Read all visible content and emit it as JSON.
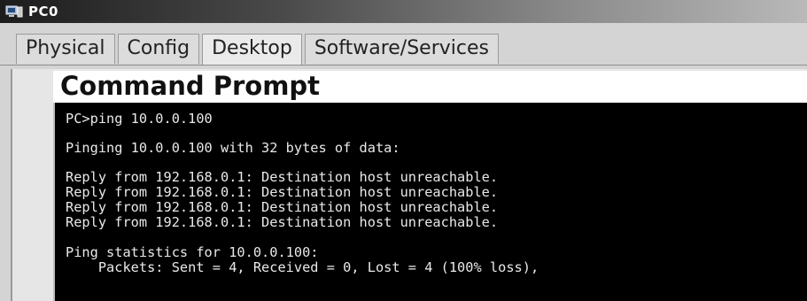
{
  "window": {
    "title": "PC0"
  },
  "tabs": [
    {
      "label": "Physical"
    },
    {
      "label": "Config"
    },
    {
      "label": "Desktop"
    },
    {
      "label": "Software/Services"
    }
  ],
  "active_tab": "Desktop",
  "command_prompt": {
    "title": "Command Prompt",
    "lines": [
      "PC>ping 10.0.0.100",
      "Pinging 10.0.0.100 with 32 bytes of data:",
      "Reply from 192.168.0.1: Destination host unreachable.",
      "Reply from 192.168.0.1: Destination host unreachable.",
      "Reply from 192.168.0.1: Destination host unreachable.",
      "Reply from 192.168.0.1: Destination host unreachable.",
      "Ping statistics for 10.0.0.100:",
      "    Packets: Sent = 4, Received = 0, Lost = 4 (100% loss),"
    ]
  }
}
